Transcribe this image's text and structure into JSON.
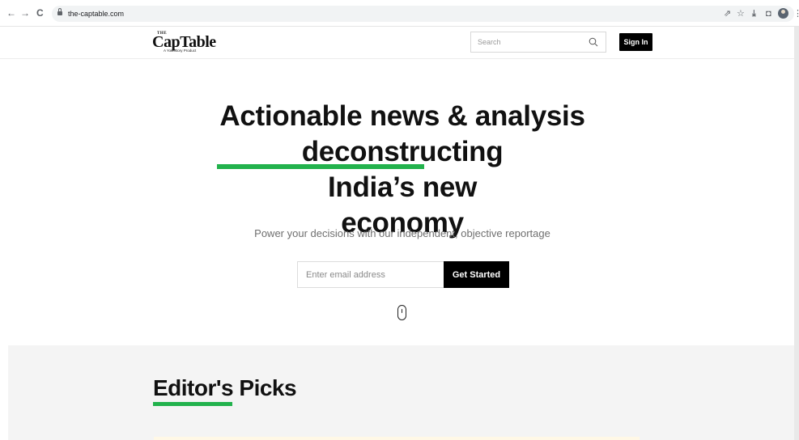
{
  "browser": {
    "back_icon": "arrow-left-icon",
    "forward_icon": "arrow-right-icon",
    "reload_icon": "reload-icon",
    "url": "the-captable.com",
    "share_icon": "share-icon",
    "star_icon": "star-icon",
    "download_icon": "download-icon",
    "window_icon": "window-icon",
    "menu_icon": "more-vert-icon"
  },
  "header": {
    "logo": {
      "the": "THE",
      "main": "CapTable",
      "sub": "A YourStory Product"
    },
    "search_placeholder": "Search",
    "signin_label": "Sign In"
  },
  "hero": {
    "title_line1": "Actionable news & analysis",
    "title_line2_highlight": "deconstructing",
    "title_line2_rest": " India’s new",
    "title_line3": "economy",
    "subtitle": "Power your decisions with our independent, objective reportage",
    "email_placeholder": "Enter email address",
    "cta_label": "Get Started"
  },
  "picks": {
    "title": "Editor's Picks"
  },
  "colors": {
    "accent_green": "#22b24c",
    "button_black": "#000000"
  }
}
